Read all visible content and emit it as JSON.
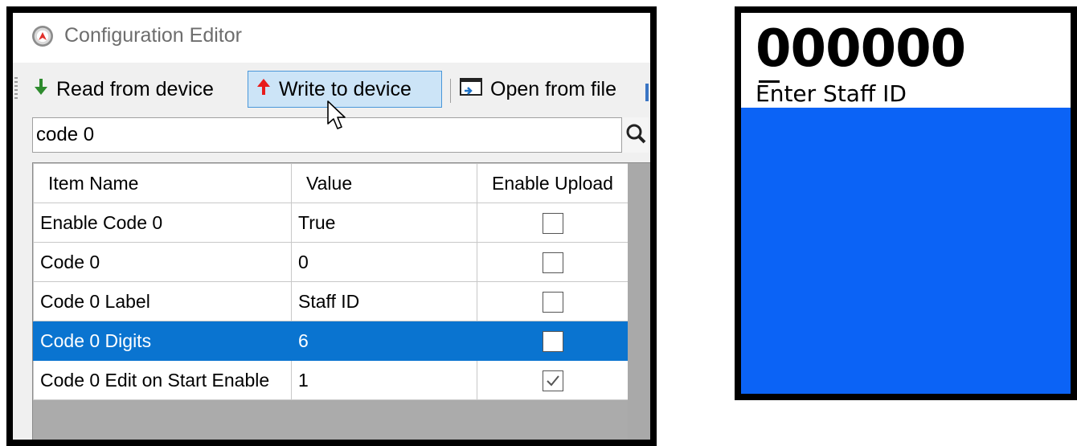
{
  "window": {
    "title": "Configuration Editor"
  },
  "toolbar": {
    "read_label": "Read from device",
    "write_label": "Write to device",
    "open_label": "Open from file"
  },
  "search": {
    "value": "code 0"
  },
  "grid": {
    "columns": [
      "Item Name",
      "Value",
      "Enable Upload"
    ],
    "rows": [
      {
        "name": "Enable Code 0",
        "value": "True",
        "upload": false,
        "selected": false
      },
      {
        "name": "Code 0",
        "value": "0",
        "upload": false,
        "selected": false
      },
      {
        "name": "Code 0 Label",
        "value": "Staff ID",
        "upload": false,
        "selected": false
      },
      {
        "name": "Code 0 Digits",
        "value": "6",
        "upload": false,
        "selected": true
      },
      {
        "name": "Code 0 Edit on Start Enable",
        "value": "1",
        "upload": true,
        "selected": false
      }
    ]
  },
  "device": {
    "code": "000000",
    "prompt": "Enter Staff ID"
  },
  "colors": {
    "selection": "#0a74d0",
    "write_button_bg": "#cce4f7",
    "device_screen": "#0b63f6",
    "read_arrow": "#2e8b2e",
    "write_arrow": "#e81b1b"
  },
  "icons": {
    "app": "app-logo-icon",
    "read": "arrow-down-icon",
    "write": "arrow-up-icon",
    "open": "open-file-icon",
    "search": "magnifier-icon",
    "cursor": "mouse-pointer-icon"
  }
}
